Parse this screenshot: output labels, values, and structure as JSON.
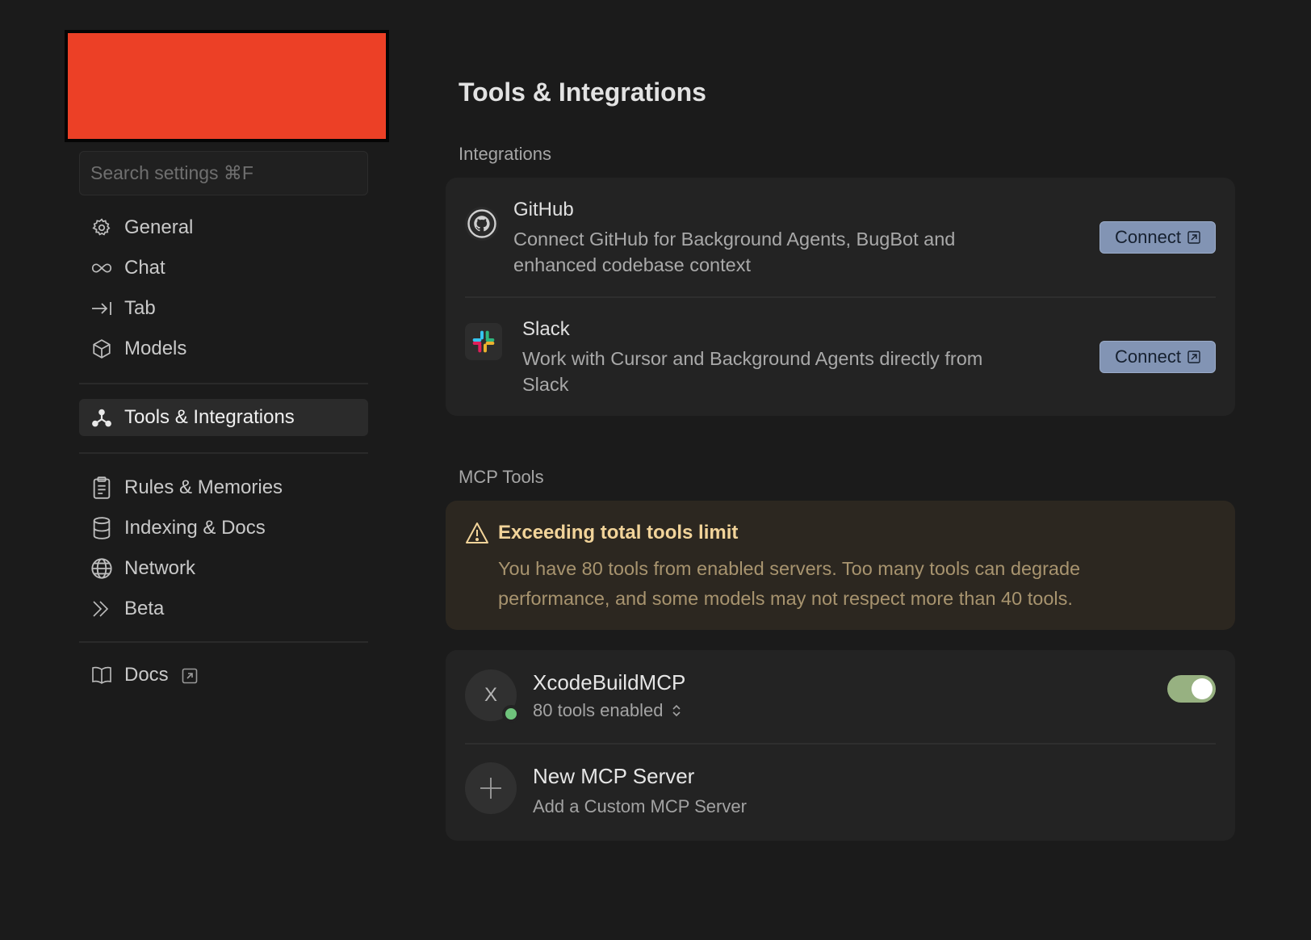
{
  "search": {
    "placeholder": "Search settings ⌘F"
  },
  "sidebar": {
    "items": [
      {
        "label": "General",
        "icon": "gear-icon"
      },
      {
        "label": "Chat",
        "icon": "infinity-icon"
      },
      {
        "label": "Tab",
        "icon": "arrow-to-line-icon"
      },
      {
        "label": "Models",
        "icon": "cube-icon"
      },
      {
        "label": "Tools & Integrations",
        "icon": "tools-icon",
        "active": true
      },
      {
        "label": "Rules & Memories",
        "icon": "clipboard-icon"
      },
      {
        "label": "Indexing & Docs",
        "icon": "database-icon"
      },
      {
        "label": "Network",
        "icon": "globe-icon"
      },
      {
        "label": "Beta",
        "icon": "chevrons-right-icon"
      },
      {
        "label": "Docs",
        "icon": "book-icon"
      }
    ]
  },
  "main": {
    "title": "Tools & Integrations",
    "integrations_label": "Integrations",
    "integrations": [
      {
        "name": "GitHub",
        "desc_line1": "Connect GitHub for Background Agents, BugBot and",
        "desc_line2": "enhanced codebase context",
        "button": "Connect"
      },
      {
        "name": "Slack",
        "desc_line1": "Work with Cursor and Background Agents directly from",
        "desc_line2": "Slack",
        "button": "Connect"
      }
    ],
    "mcp_label": "MCP Tools",
    "warning": {
      "title": "Exceeding total tools limit",
      "line1": "You have 80 tools from enabled servers. Too many tools can degrade",
      "line2": "performance, and some models may not respect more than 40 tools."
    },
    "servers": [
      {
        "avatar": "X",
        "name": "XcodeBuildMCP",
        "sub": "80 tools enabled",
        "enabled": true
      },
      {
        "name": "New MCP Server",
        "sub": "Add a Custom MCP Server"
      }
    ]
  },
  "colors": {
    "background": "#1b1b1b",
    "card": "#232323",
    "button": "#8294b4",
    "warning_bg": "#2c2720",
    "warning_title": "#f2d49a",
    "toggle_on": "#97b181",
    "status_online": "#6fc47c",
    "redacted": "#ec4026"
  }
}
